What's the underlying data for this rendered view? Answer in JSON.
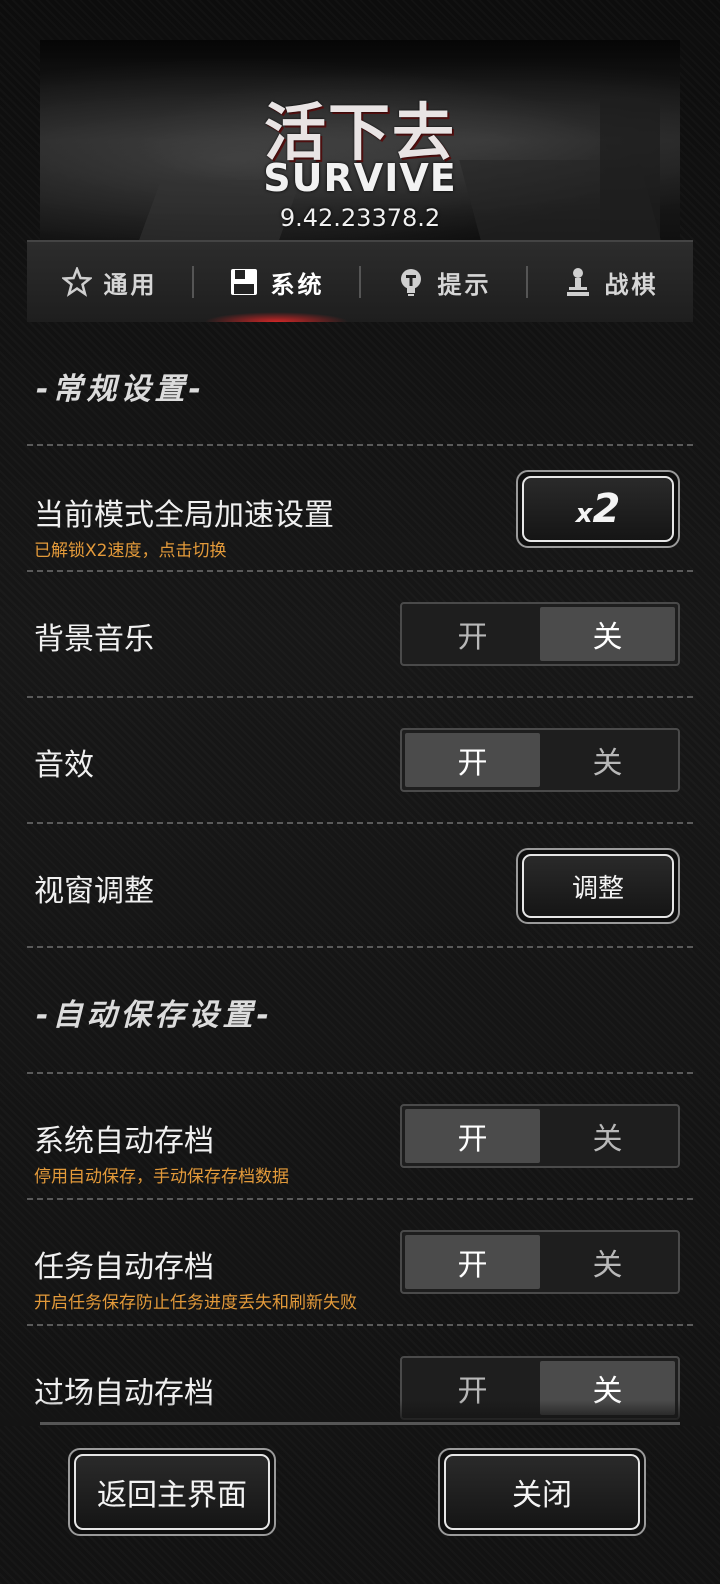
{
  "header": {
    "logo_cn": "活下去",
    "logo_en": "SURVIVE",
    "version": "9.42.23378.2"
  },
  "tabs": [
    {
      "label": "通用",
      "icon": "star-icon",
      "active": false
    },
    {
      "label": "系统",
      "icon": "floppy-disk-icon",
      "active": true
    },
    {
      "label": "提示",
      "icon": "lightbulb-icon",
      "active": false
    },
    {
      "label": "战棋",
      "icon": "chess-pawn-icon",
      "active": false
    }
  ],
  "sections": {
    "general_title": "-常规设置-",
    "autosave_title": "-自动保存设置-"
  },
  "settings": {
    "speed": {
      "label": "当前模式全局加速设置",
      "hint": "已解锁X2速度，点击切换",
      "button_x": "x",
      "button_n": "2"
    },
    "bgm": {
      "label": "背景音乐",
      "on": "开",
      "off": "关",
      "value": "off"
    },
    "sfx": {
      "label": "音效",
      "on": "开",
      "off": "关",
      "value": "on"
    },
    "viewport": {
      "label": "视窗调整",
      "button": "调整"
    },
    "system_autosave": {
      "label": "系统自动存档",
      "hint": "停用自动保存，手动保存存档数据",
      "on": "开",
      "off": "关",
      "value": "on"
    },
    "task_autosave": {
      "label": "任务自动存档",
      "hint": "开启任务保存防止任务进度丢失和刷新失败",
      "on": "开",
      "off": "关",
      "value": "on"
    },
    "cutscene_autosave": {
      "label": "过场自动存档",
      "on": "开",
      "off": "关",
      "value": "off"
    }
  },
  "footer": {
    "back_button": "返回主界面",
    "close_button": "关闭"
  },
  "colors": {
    "hint": "#e39a3a",
    "active_glow": "#e62828",
    "toggle_on": "#4b4b4b"
  }
}
